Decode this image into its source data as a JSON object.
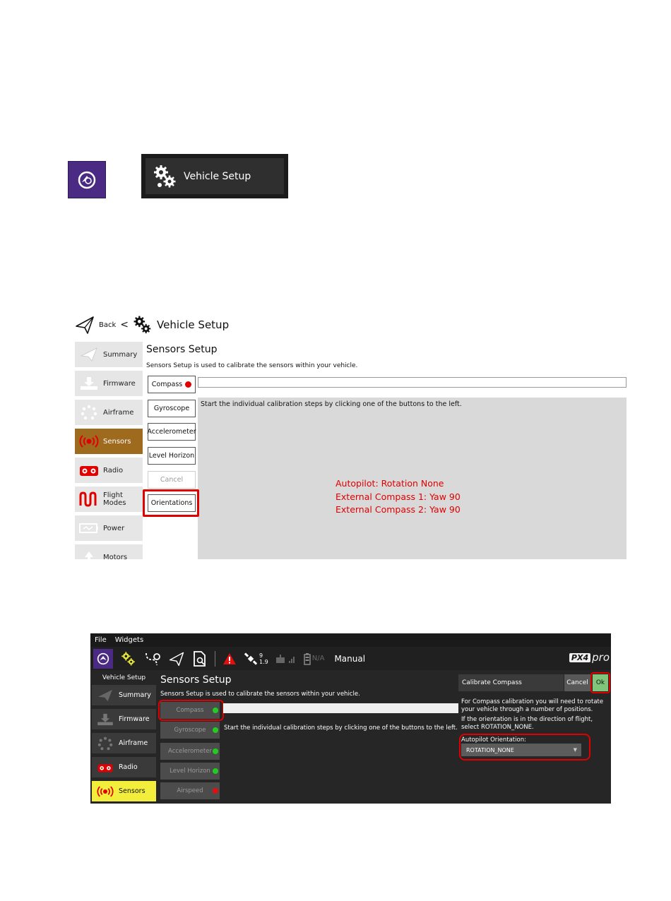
{
  "section_icons": {
    "banner_label": "Vehicle Setup"
  },
  "light": {
    "header": {
      "back": "Back",
      "separator": "<",
      "title": "Vehicle Setup"
    },
    "sidebar": [
      {
        "label": "Summary",
        "icon": "paper-plane-icon"
      },
      {
        "label": "Firmware",
        "icon": "firmware-download-icon"
      },
      {
        "label": "Airframe",
        "icon": "airframe-dots-icon"
      },
      {
        "label": "Sensors",
        "icon": "radio-signal-icon",
        "active": true
      },
      {
        "label": "Radio",
        "icon": "radio-controller-icon"
      },
      {
        "label": "Flight Modes",
        "icon": "flight-modes-wave-icon"
      },
      {
        "label": "Power",
        "icon": "power-battery-icon"
      },
      {
        "label": "Motors",
        "icon": "motors-icon"
      }
    ],
    "main_title": "Sensors Setup",
    "main_desc": "Sensors Setup is used to calibrate the sensors within your vehicle.",
    "buttons": {
      "compass": "Compass",
      "gyroscope": "Gyroscope",
      "accelerometer": "Accelerometer",
      "level_horizon": "Level Horizon",
      "cancel": "Cancel",
      "orientations": "Orientations"
    },
    "panel_text": "Start the individual calibration steps by clicking one of the buttons to the left.",
    "notes": [
      "Autopilot: Rotation None",
      "External Compass 1: Yaw 90",
      "External Compass 2: Yaw 90"
    ],
    "status_colors": {
      "not_calibrated": "#e00000",
      "active_tab": "#9e6a1e",
      "annotation": "#e00000"
    }
  },
  "dark": {
    "menu": [
      "File",
      "Widgets"
    ],
    "toolbar": {
      "satellites": "9",
      "hdop": "1.9",
      "battery": "N/A",
      "flight_mode": "Manual",
      "logo_box": "PX4",
      "logo_text": "pro"
    },
    "sidebar_title": "Vehicle Setup",
    "sidebar": [
      {
        "label": "Summary",
        "icon": "paper-plane-icon"
      },
      {
        "label": "Firmware",
        "icon": "firmware-download-icon"
      },
      {
        "label": "Airframe",
        "icon": "airframe-dots-icon"
      },
      {
        "label": "Radio",
        "icon": "radio-controller-icon"
      },
      {
        "label": "Sensors",
        "icon": "radio-signal-icon",
        "active": true
      }
    ],
    "main_title": "Sensors Setup",
    "main_desc": "Sensors Setup is used to calibrate the sensors within your vehicle.",
    "buttons": [
      {
        "label": "Compass",
        "status": "green"
      },
      {
        "label": "Gyroscope",
        "status": "green"
      },
      {
        "label": "Accelerometer",
        "status": "green"
      },
      {
        "label": "Level Horizon",
        "status": "green"
      },
      {
        "label": "Airspeed",
        "status": "red"
      }
    ],
    "panel_text": "Start the individual calibration steps by clicking one of the buttons to the left.",
    "calibrate": {
      "title": "Calibrate Compass",
      "cancel": "Cancel",
      "ok": "Ok",
      "text1": "For Compass calibration you will need to rotate your vehicle through a number of positions.",
      "text2": "If the orientation is in the direction of flight, select ROTATION_NONE.",
      "orientation_label": "Autopilot Orientation:",
      "orientation_value": "ROTATION_NONE"
    },
    "colors": {
      "active_tab": "#f2ee3b",
      "ok": "#7fc67b",
      "status_green": "#22cc22",
      "status_red": "#e01010"
    }
  }
}
